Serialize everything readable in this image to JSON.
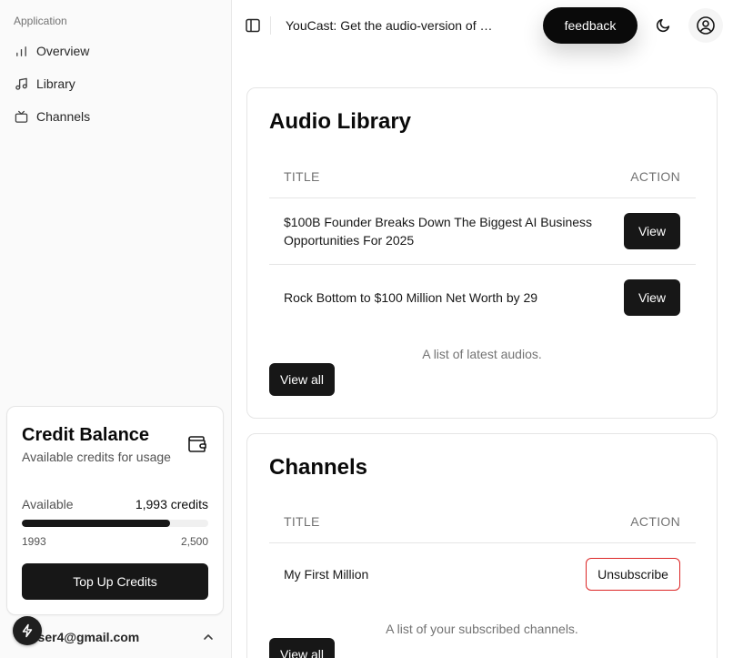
{
  "sidebar": {
    "group_label": "Application",
    "items": [
      {
        "label": "Overview",
        "icon": "bar-chart-icon"
      },
      {
        "label": "Library",
        "icon": "music-note-icon"
      },
      {
        "label": "Channels",
        "icon": "tv-icon"
      }
    ],
    "credits": {
      "title": "Credit Balance",
      "subtitle": "Available credits for usage",
      "available_label": "Available",
      "available_value": "1,993 credits",
      "used": 1993,
      "total": 2500,
      "min_label": "1993",
      "max_label": "2,500",
      "button_label": "Top Up Credits"
    },
    "user": {
      "email": "user4@gmail.com"
    }
  },
  "header": {
    "title": "YouCast: Get the audio-version of any YouTube video",
    "feedback_label": "feedback"
  },
  "library": {
    "title": "Audio Library",
    "columns": [
      "TITLE",
      "ACTION"
    ],
    "rows": [
      {
        "title": "$100B Founder Breaks Down The Biggest AI Business Opportunities For 2025",
        "action": "View"
      },
      {
        "title": "Rock Bottom to $100 Million Net Worth by 29",
        "action": "View"
      }
    ],
    "caption": "A list of latest audios.",
    "view_all_label": "View all"
  },
  "channels": {
    "title": "Channels",
    "columns": [
      "TITLE",
      "ACTION"
    ],
    "rows": [
      {
        "title": "My First Million",
        "action": "Unsubscribe"
      }
    ],
    "caption": "A list of your subscribed channels.",
    "view_all_label": "View all"
  },
  "colors": {
    "primary": "#171717",
    "destructive_border": "#dc2626",
    "sidebar_bg": "#fafafa"
  }
}
